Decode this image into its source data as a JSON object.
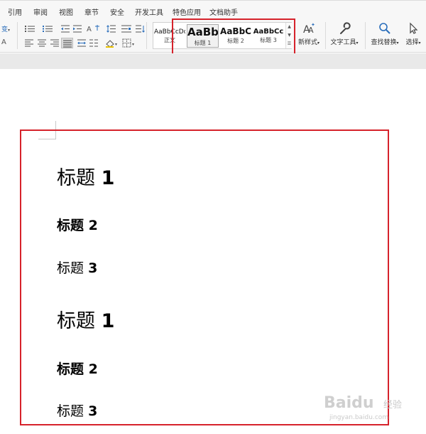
{
  "menu": {
    "items": [
      "引用",
      "审阅",
      "视图",
      "章节",
      "安全",
      "开发工具",
      "特色应用",
      "文档助手"
    ]
  },
  "ribbon": {
    "phonetic_label": "变",
    "font_size_hint": "A",
    "styles": [
      {
        "preview": "AaBbCcDd",
        "name": "正文"
      },
      {
        "preview": "AaBb",
        "name": "标题 1"
      },
      {
        "preview": "AaBbC",
        "name": "标题 2"
      },
      {
        "preview": "AaBbCc",
        "name": "标题 3"
      }
    ],
    "new_style_label": "新样式",
    "text_tools_label": "文字工具",
    "find_replace_label": "查找替换",
    "select_label": "选择"
  },
  "document": {
    "headings": [
      {
        "label": "标题",
        "num": "1",
        "level": 1
      },
      {
        "label": "标题",
        "num": "2",
        "level": 2
      },
      {
        "label": "标题",
        "num": "3",
        "level": 3
      },
      {
        "label": "标题",
        "num": "1",
        "level": 1
      },
      {
        "label": "标题",
        "num": "2",
        "level": 2
      },
      {
        "label": "标题",
        "num": "3",
        "level": 3
      }
    ]
  },
  "watermark": {
    "text": "Baidu",
    "sub": "经验",
    "url": "jingyan.baidu.com"
  },
  "colors": {
    "highlight": "#d6222b",
    "ribbon_bg": "#f7f7f7"
  }
}
